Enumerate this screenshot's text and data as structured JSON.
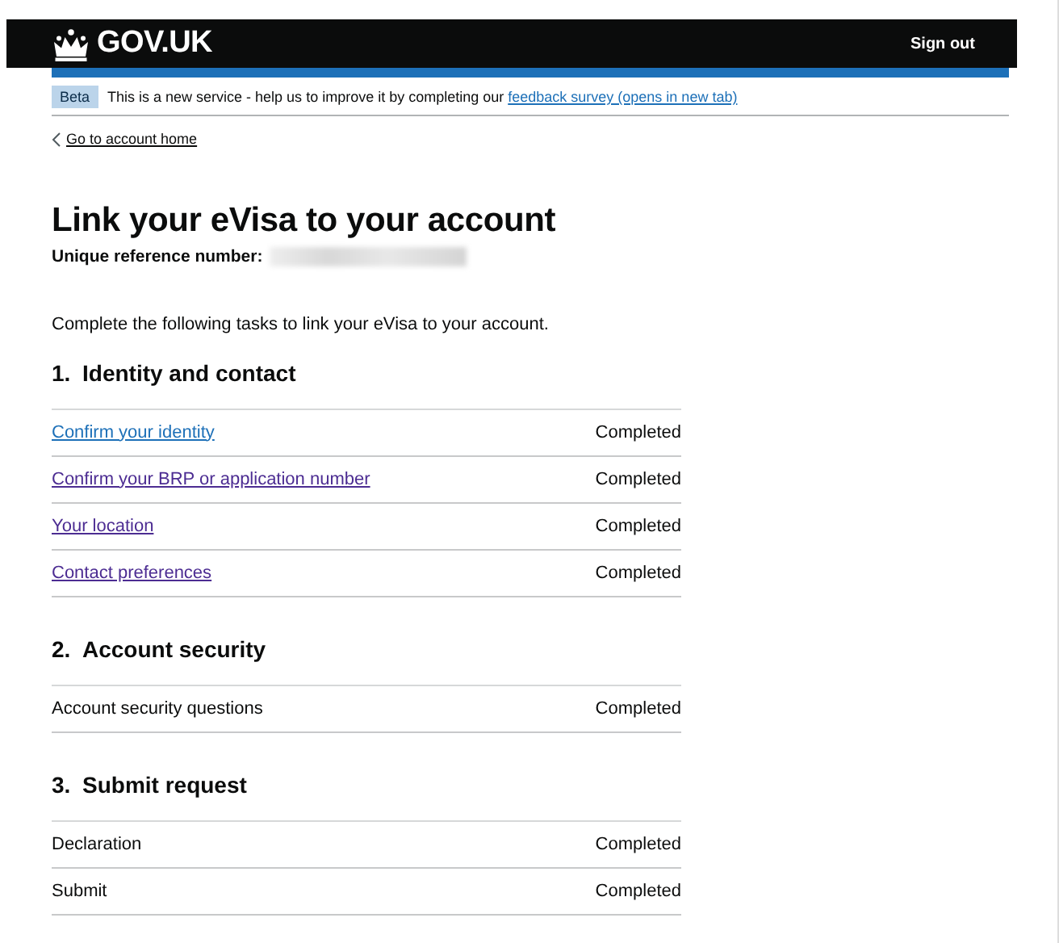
{
  "header": {
    "logo": "GOV.UK",
    "sign_out": "Sign out"
  },
  "phase_banner": {
    "tag": "Beta",
    "text": "This is a new service - help us to improve it by completing our",
    "link": "feedback survey (opens in new tab)"
  },
  "back_link": "Go to account home",
  "title": "Link your eVisa to your account",
  "reference_label": "Unique reference number:",
  "intro": "Complete the following tasks to link your eVisa to your account.",
  "sections": [
    {
      "number": "1.",
      "heading": "Identity and contact",
      "tasks": [
        {
          "kind": "link",
          "label": "Confirm your identity",
          "visited": false,
          "status": "Completed"
        },
        {
          "kind": "link",
          "label": "Confirm your BRP or application number",
          "visited": true,
          "status": "Completed"
        },
        {
          "kind": "link",
          "label": "Your location",
          "visited": true,
          "status": "Completed"
        },
        {
          "kind": "link",
          "label": "Contact preferences",
          "visited": true,
          "status": "Completed"
        }
      ]
    },
    {
      "number": "2.",
      "heading": "Account security",
      "tasks": [
        {
          "kind": "text",
          "label": "Account security questions",
          "status": "Completed"
        }
      ]
    },
    {
      "number": "3.",
      "heading": "Submit request",
      "tasks": [
        {
          "kind": "text",
          "label": "Declaration",
          "status": "Completed"
        },
        {
          "kind": "text",
          "label": "Submit",
          "status": "Completed"
        }
      ]
    }
  ]
}
